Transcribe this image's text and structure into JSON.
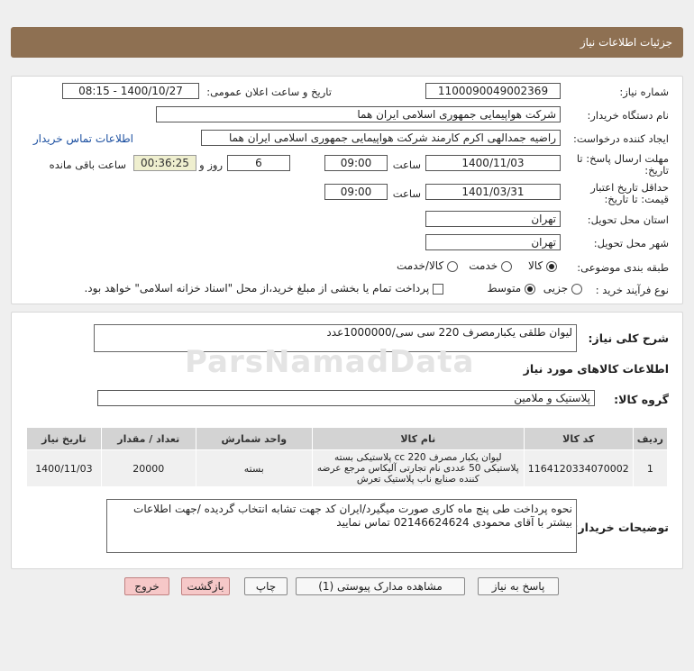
{
  "header": {
    "title": "جزئیات اطلاعات نیاز"
  },
  "form": {
    "need_number_label": "شماره نیاز:",
    "need_number": "1100090049002369",
    "announce_label": "تاریخ و ساعت اعلان عمومی:",
    "announce_value": "1400/10/27 - 08:15",
    "buyer_label": "نام دستگاه خریدار:",
    "buyer_value": "شرکت هواپیمایی جمهوری اسلامی ایران هما",
    "creator_label": "ایجاد کننده درخواست:",
    "creator_value": "راضیه جمدالهی اکرم کارمند شرکت هواپیمایی جمهوری اسلامی ایران هما",
    "contact_link": "اطلاعات تماس خریدار",
    "deadline_label_1": "مهلت ارسال پاسخ: تا",
    "deadline_label_2": "تاریخ:",
    "deadline_date": "1400/11/03",
    "time_label": "ساعت",
    "deadline_time": "09:00",
    "days_value": "6",
    "days_label": "روز و",
    "remaining_time": "00:36:25",
    "remaining_label": "ساعت باقی مانده",
    "validity_label_1": "حداقل تاریخ اعتبار",
    "validity_label_2": "قیمت: تا تاریخ:",
    "validity_date": "1401/03/31",
    "validity_time_label": "ساعت",
    "validity_time": "09:00",
    "province_label": "استان محل تحویل:",
    "province_value": "تهران",
    "city_label": "شهر محل تحویل:",
    "city_value": "تهران",
    "category_label": "طبقه بندی موضوعی:",
    "category_options": [
      "کالا",
      "خدمت",
      "کالا/خدمت"
    ],
    "process_label": "نوع فرآیند خرید :",
    "process_options": [
      "جزیی",
      "متوسط"
    ],
    "payment_note": "پرداخت تمام یا بخشی از مبلغ خرید،از محل \"اسناد خزانه اسلامی\" خواهد بود."
  },
  "details": {
    "summary_label": "شرح کلی نیاز:",
    "summary_value": "لیوان طلقی یکبارمصرف 220 سی سی/1000000عدد",
    "goods_info_title": "اطلاعات کالاهای مورد نیاز",
    "group_label": "گروه کالا:",
    "group_value": "پلاستیک و ملامین",
    "table": {
      "headers": [
        "ردیف",
        "کد کالا",
        "نام کالا",
        "واحد شمارش",
        "تعداد / مقدار",
        "تاریخ نیاز"
      ],
      "rows": [
        {
          "index": "1",
          "code": "1164120334070002",
          "name": "لیوان یکبار مصرف cc 220 پلاستیکی بسته پلاستیکی 50 عددی نام تجارتی آلیکاس مرجع عرضه کننده صنایع ناب پلاستیک تعرش",
          "unit": "بسته",
          "qty": "20000",
          "date": "1400/11/03"
        }
      ]
    },
    "buyer_notes_label": "توضیحات خریدار:",
    "buyer_notes": "نحوه پرداخت طی پنج ماه کاری صورت میگیرد/ایران کد جهت تشابه انتخاب گردیده /جهت اطلاعات بیشتر با آقای محمودی 02146624624 تماس نمایید"
  },
  "watermark": "ParsNamadData",
  "buttons": {
    "reply": "پاسخ به نیاز",
    "attachments": "مشاهده مدارک پیوستی (1)",
    "print": "چاپ",
    "back": "بازگشت",
    "exit": "خروج"
  }
}
